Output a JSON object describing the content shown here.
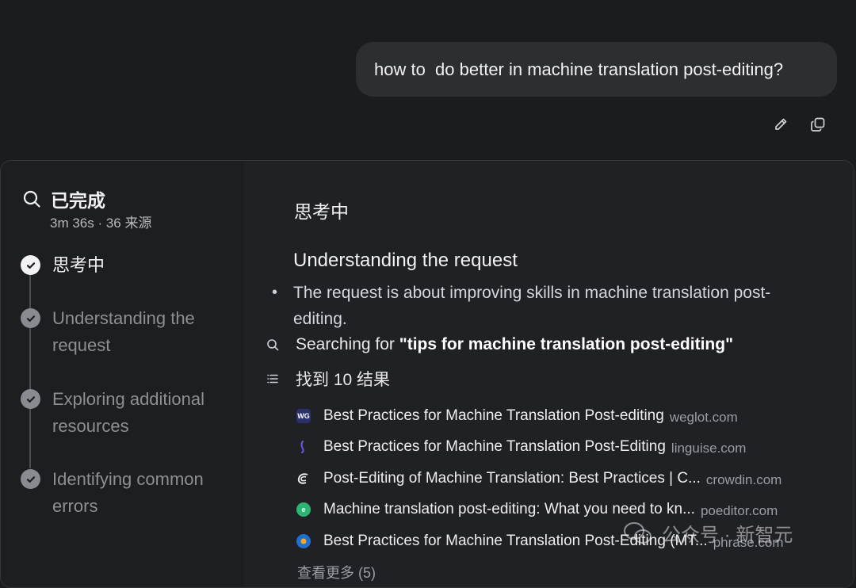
{
  "user_message": "how to  do better in machine translation post-editing?",
  "message_actions": {
    "edit_icon": "pencil-icon",
    "copy_icon": "copy-icon"
  },
  "status": {
    "title": "已完成",
    "meta": "3m 36s · 36 来源"
  },
  "steps": [
    {
      "label": "思考中",
      "state": "active"
    },
    {
      "label": "Understanding the request",
      "state": "done"
    },
    {
      "label": "Exploring additional resources",
      "state": "done"
    },
    {
      "label": "Identifying common errors",
      "state": "done"
    }
  ],
  "content": {
    "section_title": "思考中",
    "sub_heading": "Understanding the request",
    "bullet": "The request is about improving skills in machine translation post-editing.",
    "search_prefix": "Searching for ",
    "search_query": "\"tips for machine translation post-editing\"",
    "found": "找到 10 结果",
    "results": [
      {
        "title": "Best Practices for Machine Translation Post-editing",
        "domain": "weglot.com",
        "favicon_text": "WG",
        "favicon_color": "#2b2f6b"
      },
      {
        "title": "Best Practices for Machine Translation Post-Editing",
        "domain": "linguise.com",
        "favicon_text": "",
        "favicon_color": "#5a4fcf"
      },
      {
        "title": "Post-Editing of Machine Translation: Best Practices | C...",
        "domain": "crowdin.com",
        "favicon_text": "",
        "favicon_color": "#3a3b40"
      },
      {
        "title": "Machine translation post-editing: What you need to kn...",
        "domain": "poeditor.com",
        "favicon_text": "e",
        "favicon_color": "#2bb673"
      },
      {
        "title": "Best Practices for Machine Translation Post-Editing (MT...",
        "domain": "phrase.com",
        "favicon_text": "",
        "favicon_color": "#1f6fd1"
      }
    ],
    "more": "查看更多 (5)"
  },
  "watermark": "公众号 · 新智元"
}
